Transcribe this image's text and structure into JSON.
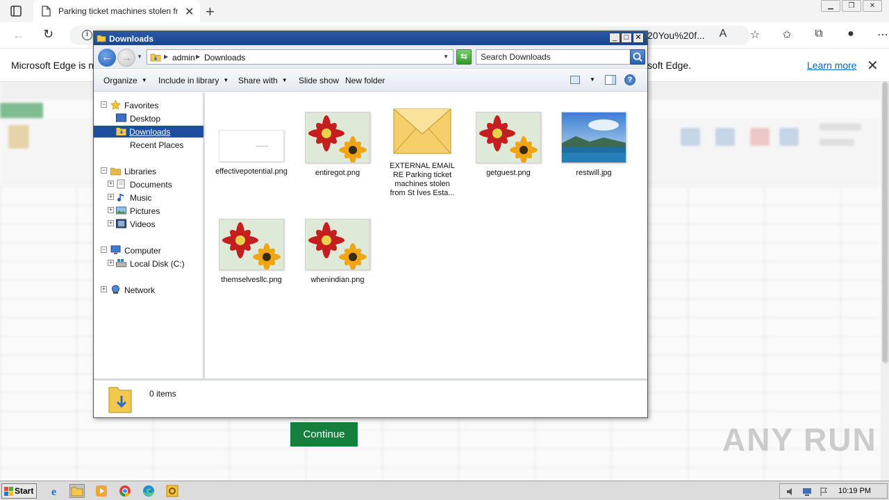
{
  "browser": {
    "tab_title": "Parking ticket machines stolen fr",
    "url_fragment": "20You%20f...",
    "infobar_message": "Microsoft Edge is no",
    "infobar_message_tail": "soft Edge.",
    "learn_more": "Learn more"
  },
  "background": {
    "continue_label": "Continue",
    "watermark": "ANY RUN"
  },
  "explorer": {
    "title": "Downloads",
    "path": [
      "admin",
      "Downloads"
    ],
    "search_placeholder": "Search Downloads",
    "toolbar": {
      "organize": "Organize",
      "include_in_library": "Include in library",
      "share_with": "Share with",
      "slide_show": "Slide show",
      "new_folder": "New folder"
    },
    "nav": {
      "favorites": "Favorites",
      "desktop": "Desktop",
      "downloads": "Downloads",
      "recent_places": "Recent Places",
      "libraries": "Libraries",
      "documents": "Documents",
      "music": "Music",
      "pictures": "Pictures",
      "videos": "Videos",
      "computer": "Computer",
      "local_disk": "Local Disk (C:)",
      "network": "Network"
    },
    "files": [
      {
        "name": "effectivepotential.png",
        "kind": "blank-image"
      },
      {
        "name": "entiregot.png",
        "kind": "flowers-image"
      },
      {
        "name": "EXTERNAL EMAIL RE Parking ticket machines stolen from St Ives Esta...",
        "kind": "email-icon"
      },
      {
        "name": "getguest.png",
        "kind": "flowers-image"
      },
      {
        "name": "restwill.jpg",
        "kind": "landscape-image"
      },
      {
        "name": "themselvesllc.png",
        "kind": "flowers-image"
      },
      {
        "name": "whenindian.png",
        "kind": "flowers-image"
      }
    ],
    "status": "0 items"
  },
  "taskbar": {
    "start": "Start",
    "clock": "10:19 PM"
  },
  "colors": {
    "titlebar": "#1f4da0",
    "selection": "#1f4da0",
    "continue_button": "#15803d",
    "edge_link": "#0066cc"
  }
}
